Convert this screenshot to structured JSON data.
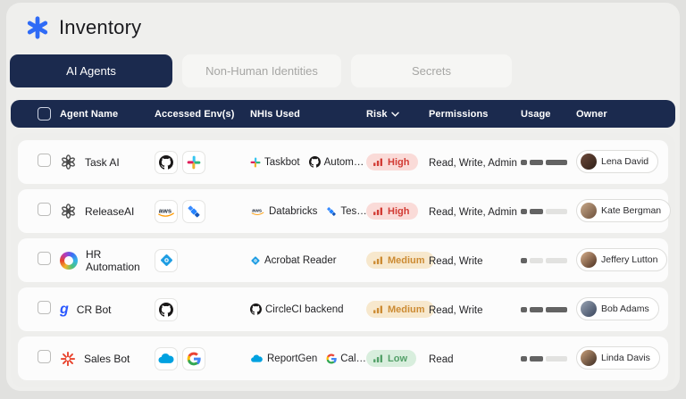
{
  "page": {
    "title": "Inventory"
  },
  "brand": {
    "accent": "#2f6bf6",
    "navy": "#1b2a4e"
  },
  "tabs": [
    {
      "id": "ai-agents",
      "label": "AI Agents",
      "active": true
    },
    {
      "id": "non-human-identities",
      "label": "Non-Human Identities",
      "active": false
    },
    {
      "id": "secrets",
      "label": "Secrets",
      "active": false
    }
  ],
  "table": {
    "header": {
      "agent_name": "Agent Name",
      "accessed_envs": "Accessed Env(s)",
      "nhis_used": "NHIs Used",
      "risk": "Risk",
      "risk_sort_icon": "chevron-down",
      "permissions": "Permissions",
      "usage": "Usage",
      "owner": "Owner"
    },
    "risk_styles": {
      "High": {
        "bg": "#fadbd8",
        "fg": "#d23b34"
      },
      "Medium": {
        "bg": "#f7e8cd",
        "fg": "#cc8b33"
      },
      "Low": {
        "bg": "#d8eedd",
        "fg": "#53a068"
      }
    },
    "usage_colors": {
      "on": "#636363",
      "off": "#e2e2e0"
    },
    "rows": [
      {
        "agent": {
          "name": "Task AI",
          "icon": "openai"
        },
        "envs": [
          "github",
          "slack"
        ],
        "nhis": [
          {
            "icon": "slack",
            "label": "Taskbot"
          },
          {
            "icon": "github",
            "label": "Autom…"
          }
        ],
        "risk": "High",
        "permissions": "Read, Write, Admin",
        "usage": [
          1,
          1,
          1
        ],
        "owner": {
          "name": "Lena David"
        }
      },
      {
        "agent": {
          "name": "ReleaseAI",
          "icon": "openai"
        },
        "envs": [
          "aws",
          "jira"
        ],
        "nhis": [
          {
            "icon": "aws",
            "label": "Databricks"
          },
          {
            "icon": "jira",
            "label": "Tes…"
          }
        ],
        "risk": "High",
        "permissions": "Read, Write, Admin",
        "usage": [
          1,
          1,
          0
        ],
        "owner": {
          "name": "Kate Bergman"
        }
      },
      {
        "agent": {
          "name": "HR Automation",
          "icon": "copilot"
        },
        "envs": [
          "blue-diamond"
        ],
        "nhis": [
          {
            "icon": "blue-diamond",
            "label": "Acrobat Reader"
          }
        ],
        "risk": "Medium",
        "permissions": "Read, Write",
        "usage": [
          1,
          0,
          0
        ],
        "owner": {
          "name": "Jeffery Lutton"
        }
      },
      {
        "agent": {
          "name": "CR Bot",
          "icon": "g-logo"
        },
        "envs": [
          "github"
        ],
        "nhis": [
          {
            "icon": "github",
            "label": "CircleCI backend"
          }
        ],
        "risk": "Medium",
        "permissions": "Read, Write",
        "usage": [
          1,
          1,
          1
        ],
        "owner": {
          "name": "Bob Adams"
        }
      },
      {
        "agent": {
          "name": "Sales Bot",
          "icon": "starburst"
        },
        "envs": [
          "salesforce",
          "google"
        ],
        "nhis": [
          {
            "icon": "salesforce",
            "label": "ReportGen"
          },
          {
            "icon": "google",
            "label": "Cal…"
          }
        ],
        "risk": "Low",
        "permissions": "Read",
        "usage": [
          1,
          1,
          0
        ],
        "owner": {
          "name": "Linda Davis"
        }
      }
    ]
  }
}
